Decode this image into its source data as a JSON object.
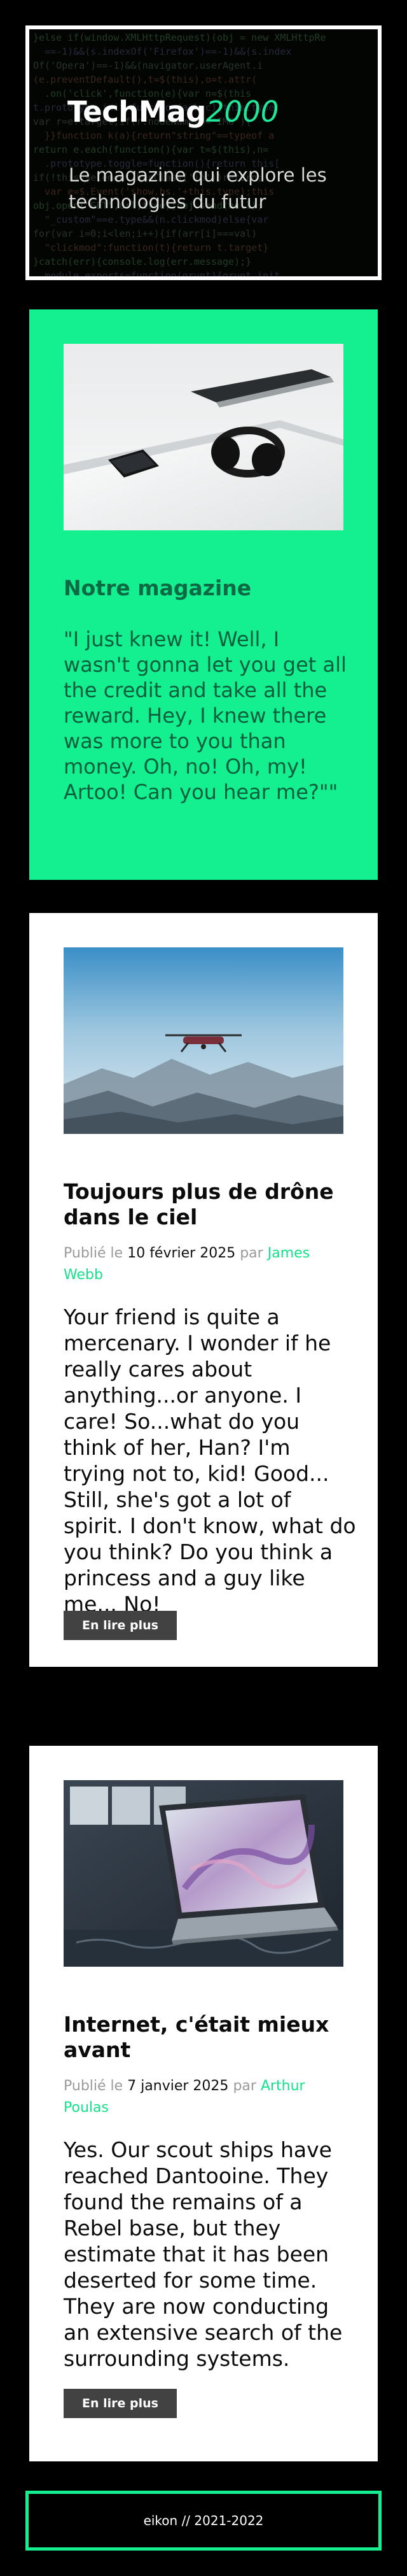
{
  "header": {
    "logo_main": "TechMag",
    "logo_year": "2000",
    "tagline": "Le magazine qui explore les technologies du futur"
  },
  "about": {
    "image_alt": "headphones-phone-laptop-photo",
    "title": "Notre magazine",
    "quote": "\"I just knew it! Well, I wasn't gonna let you get all the credit and take all the reward. Hey, I knew there was more to you than money. Oh, no! Oh, my! Artoo! Can you hear me?\"\""
  },
  "articles": [
    {
      "title": "Toujours plus de drône dans le ciel",
      "published_prefix": "Publié le",
      "date": "10 février 2025",
      "by": "par",
      "author": "James Webb",
      "body": "Your friend is quite a mercenary. I wonder if he really cares about anything...or anyone. I care! So...what do you think of her, Han? I'm trying not to, kid! Good... Still, she's got a lot of spirit. I don't know, what do you think? Do you think a princess and a guy like me... No!",
      "button": "En lire plus"
    },
    {
      "title": "Internet, c'était mieux avant",
      "published_prefix": "Publié le",
      "date": "7 janvier 2025",
      "by": "par",
      "author": "Arthur Poulas",
      "body": "Yes. Our scout ships have reached Dantooine. They found the remains of a Rebel base, but they estimate that it has been deserted for some time. They are now conducting an extensive search of the surrounding systems.",
      "button": "En lire plus"
    }
  ],
  "footer": {
    "text": "eikon // 2021-2022"
  },
  "colors": {
    "accent": "#14ef90",
    "background": "#000000",
    "button": "#424242"
  }
}
